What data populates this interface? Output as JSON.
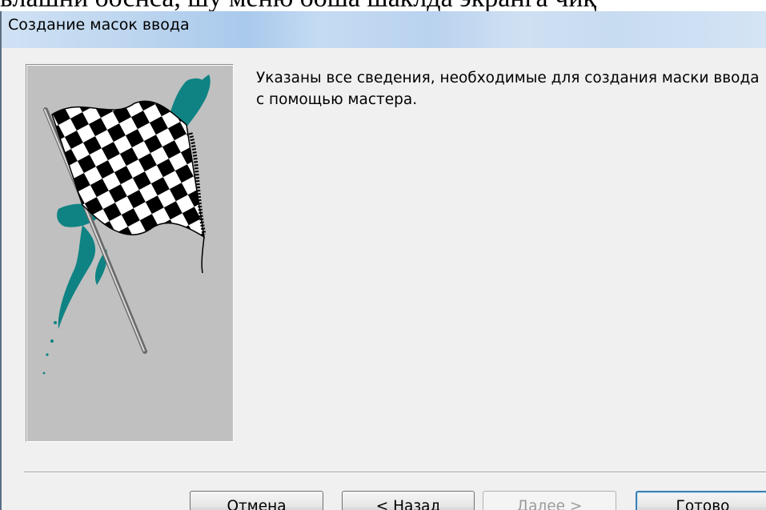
{
  "background_text": "ьлашни ооснса, шу меню ооша шаклда экранга чиқ",
  "window": {
    "title": "Создание масок ввода"
  },
  "message": "Указаны все сведения, необходимые для создания маски ввода с помощью мастера.",
  "buttons": {
    "cancel": "Отмена",
    "back_prefix": "< ",
    "back_mnemonic": "Н",
    "back_rest": "азад",
    "next_mnemonic": "Д",
    "next_rest": "алее >",
    "finish_mnemonic": "Г",
    "finish_rest": "отово"
  },
  "colors": {
    "accent_teal": "#0f8383",
    "title_bar": "#bcd5ef",
    "dialog_bg": "#f0f0f0"
  },
  "icons": [
    "checkered-flag-icon"
  ]
}
